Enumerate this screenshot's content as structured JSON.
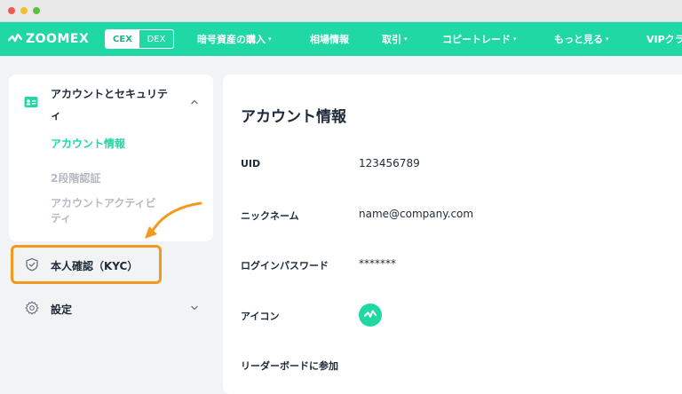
{
  "navbar": {
    "logo_text": "ZOOMEX",
    "cex_label": "CEX",
    "dex_label": "DEX",
    "items": [
      {
        "label": "暗号資産の購入",
        "dropdown": true
      },
      {
        "label": "相場情報",
        "dropdown": false
      },
      {
        "label": "取引",
        "dropdown": true
      },
      {
        "label": "コピートレード",
        "dropdown": true
      },
      {
        "label": "もっと見る",
        "dropdown": true
      },
      {
        "label": "VIPクラ",
        "dropdown": false
      }
    ],
    "caret": "▾",
    "brand_color": "#1fd8a4"
  },
  "sidebar": {
    "account_section": {
      "title_line1": "アカウントとセキュリテ",
      "title_line2": "ィ",
      "expanded": true,
      "items": [
        {
          "label": "アカウント情報",
          "active": true
        },
        {
          "label": "2段階認証",
          "active": false
        },
        {
          "label": "アカウントアクティビ",
          "label_line2": "ティ",
          "active": false
        }
      ]
    },
    "kyc_item": {
      "label": "本人確認（KYC）",
      "highlighted": true,
      "highlight_color": "#f39a1e"
    },
    "settings_item": {
      "label": "設定",
      "expanded": false
    }
  },
  "main": {
    "title": "アカウント情報",
    "fields": [
      {
        "label": "UID",
        "value": "123456789"
      },
      {
        "label": "ニックネーム",
        "value": "name@company.com"
      },
      {
        "label": "ログインパスワード",
        "value": "*******"
      },
      {
        "label": "アイコン",
        "value": ""
      },
      {
        "label": "リーダーボードに参加",
        "value": ""
      }
    ]
  }
}
